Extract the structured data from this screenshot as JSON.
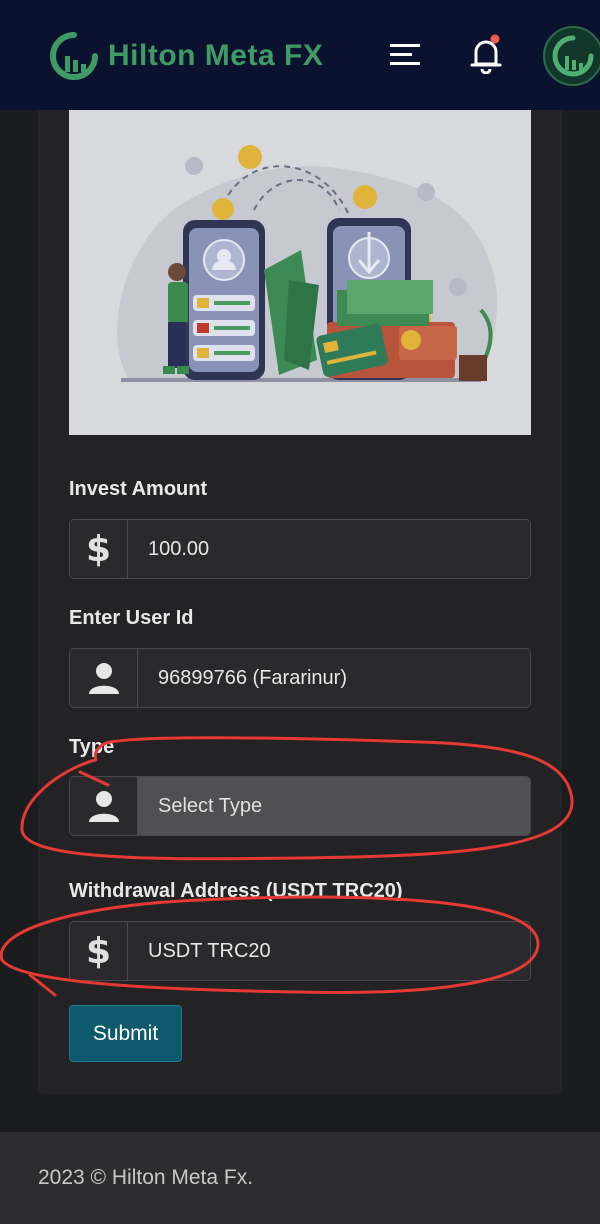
{
  "header": {
    "brand_name": "Hilton Meta FX",
    "logo_icon": "bar-chart-ring-logo",
    "menu_icon": "hamburger-menu-icon",
    "bell_icon": "bell-icon",
    "notification_dot_color": "#f05a4f",
    "brand_color": "#3f9a63",
    "background_color": "#0b1230"
  },
  "form": {
    "invest_amount": {
      "label": "Invest Amount",
      "value": "100.00",
      "icon": "dollar-icon"
    },
    "user_id": {
      "label": "Enter User Id",
      "value": "96899766 (Fararinur)",
      "icon": "user-icon"
    },
    "type": {
      "label": "Type",
      "selected": "Select Type",
      "icon": "user-icon"
    },
    "withdrawal_address": {
      "label": "Withdrawal Address (USDT TRC20)",
      "value": "USDT TRC20",
      "icon": "dollar-icon"
    },
    "submit_label": "Submit",
    "submit_color": "#0e5a6c"
  },
  "footer": {
    "copyright": "2023 © Hilton Meta Fx."
  },
  "annotation": {
    "color": "#e53935"
  }
}
